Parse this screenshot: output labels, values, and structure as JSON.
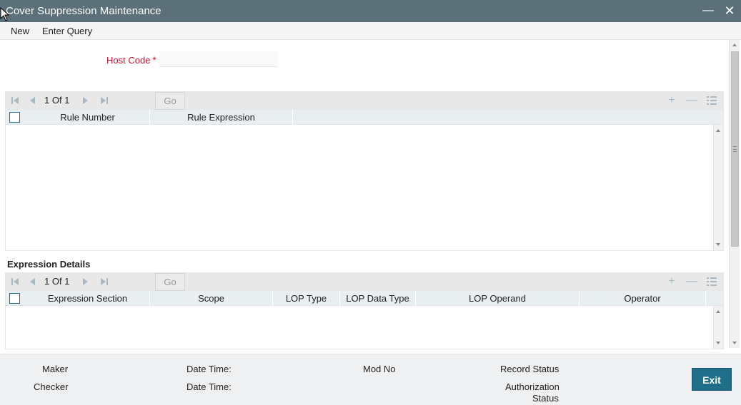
{
  "window": {
    "title": "Cover Suppression Maintenance",
    "minimize_glyph": "—",
    "close_glyph": "✕"
  },
  "menu": {
    "new_label": "New",
    "enter_query_label": "Enter Query"
  },
  "form": {
    "host_code_label": "Host Code",
    "required_mark": "*",
    "host_code_value": ""
  },
  "rules_grid": {
    "pager": "1 Of 1",
    "go_label": "Go",
    "columns": [
      "Rule Number",
      "Rule Expression"
    ]
  },
  "expression_details": {
    "section_title": "Expression Details",
    "pager": "1 Of 1",
    "go_label": "Go",
    "columns": [
      "Expression Section",
      "Scope",
      "LOP Type",
      "LOP Data Type",
      "LOP Operand",
      "Operator"
    ]
  },
  "footer": {
    "maker_label": "Maker",
    "checker_label": "Checker",
    "date_time_label_1": "Date Time:",
    "date_time_label_2": "Date Time:",
    "mod_no_label": "Mod No",
    "record_status_label": "Record Status",
    "authorization_status_label_1": "Authorization",
    "authorization_status_label_2": "Status",
    "exit_label": "Exit"
  },
  "icons": {
    "first": "first-page-icon",
    "prev": "previous-page-icon",
    "next": "next-page-icon",
    "last": "last-page-icon",
    "add": "add-row-icon",
    "remove": "delete-row-icon",
    "view": "single-view-icon"
  },
  "colors": {
    "title_bar": "#5b7078",
    "accent": "#1f6f8b",
    "required": "#c8102e",
    "nav_icon": "#a9b9c4"
  }
}
